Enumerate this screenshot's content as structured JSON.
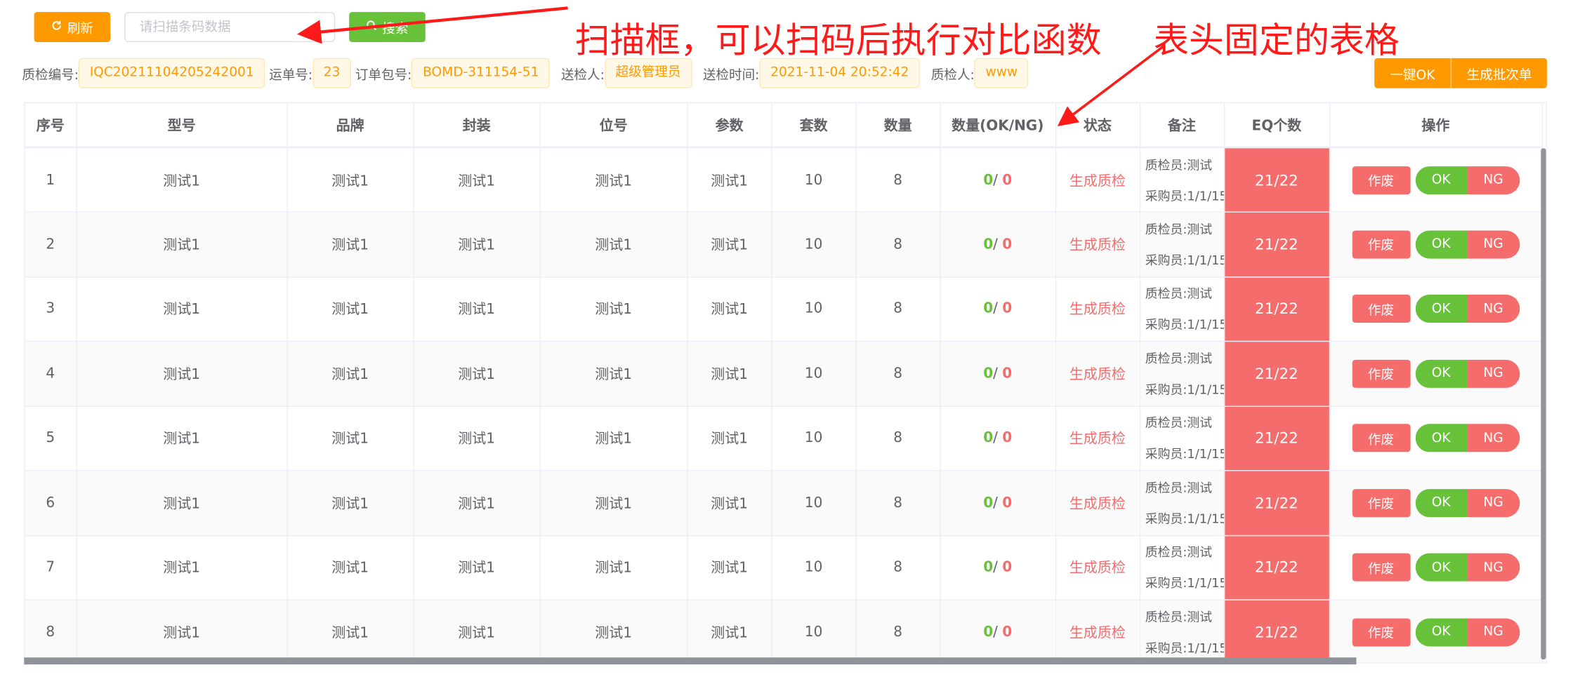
{
  "toolbar": {
    "refresh_label": "刷新",
    "scan_placeholder": "请扫描条码数据",
    "search_label": "搜索"
  },
  "info": {
    "qc_no_label": "质检编号:",
    "qc_no": "IQC20211104205242001",
    "waybill_label": "运单号:",
    "waybill": "23",
    "order_pkg_label": "订单包号:",
    "order_pkg": "BOMD-311154-51",
    "sender_label": "送检人:",
    "sender": "超级管理员",
    "send_time_label": "送检时间:",
    "send_time": "2021-11-04 20:52:42",
    "inspector_label": "质检人:",
    "inspector": "www"
  },
  "actions": {
    "one_key_ok": "一键OK",
    "gen_batch": "生成批次单"
  },
  "annotations": {
    "scan_box": "扫描框，可以扫码后执行对比函数",
    "fixed_header": "表头固定的表格",
    "color": "#ff1a1a"
  },
  "table": {
    "headers": [
      "序号",
      "型号",
      "品牌",
      "封装",
      "位号",
      "参数",
      "套数",
      "数量",
      "数量(OK/NG)",
      "状态",
      "备注",
      "EQ个数",
      "操作"
    ],
    "rows": [
      {
        "no": "1",
        "model": "测试1",
        "brand": "测试1",
        "pkg": "测试1",
        "pos": "测试1",
        "param": "测试1",
        "sets": "10",
        "qty": "8",
        "ok": "0",
        "slash": "/",
        "ng": "0",
        "status": "生成质检",
        "note1": "质检员:测试",
        "note2": "采购员:1/1/15",
        "eq": "21/22",
        "void": "作废",
        "okbtn": "OK",
        "ngbtn": "NG"
      },
      {
        "no": "2",
        "model": "测试1",
        "brand": "测试1",
        "pkg": "测试1",
        "pos": "测试1",
        "param": "测试1",
        "sets": "10",
        "qty": "8",
        "ok": "0",
        "slash": "/",
        "ng": "0",
        "status": "生成质检",
        "note1": "质检员:测试",
        "note2": "采购员:1/1/15",
        "eq": "21/22",
        "void": "作废",
        "okbtn": "OK",
        "ngbtn": "NG"
      },
      {
        "no": "3",
        "model": "测试1",
        "brand": "测试1",
        "pkg": "测试1",
        "pos": "测试1",
        "param": "测试1",
        "sets": "10",
        "qty": "8",
        "ok": "0",
        "slash": "/",
        "ng": "0",
        "status": "生成质检",
        "note1": "质检员:测试",
        "note2": "采购员:1/1/15",
        "eq": "21/22",
        "void": "作废",
        "okbtn": "OK",
        "ngbtn": "NG"
      },
      {
        "no": "4",
        "model": "测试1",
        "brand": "测试1",
        "pkg": "测试1",
        "pos": "测试1",
        "param": "测试1",
        "sets": "10",
        "qty": "8",
        "ok": "0",
        "slash": "/",
        "ng": "0",
        "status": "生成质检",
        "note1": "质检员:测试",
        "note2": "采购员:1/1/15",
        "eq": "21/22",
        "void": "作废",
        "okbtn": "OK",
        "ngbtn": "NG"
      },
      {
        "no": "5",
        "model": "测试1",
        "brand": "测试1",
        "pkg": "测试1",
        "pos": "测试1",
        "param": "测试1",
        "sets": "10",
        "qty": "8",
        "ok": "0",
        "slash": "/",
        "ng": "0",
        "status": "生成质检",
        "note1": "质检员:测试",
        "note2": "采购员:1/1/15",
        "eq": "21/22",
        "void": "作废",
        "okbtn": "OK",
        "ngbtn": "NG"
      },
      {
        "no": "6",
        "model": "测试1",
        "brand": "测试1",
        "pkg": "测试1",
        "pos": "测试1",
        "param": "测试1",
        "sets": "10",
        "qty": "8",
        "ok": "0",
        "slash": "/",
        "ng": "0",
        "status": "生成质检",
        "note1": "质检员:测试",
        "note2": "采购员:1/1/15",
        "eq": "21/22",
        "void": "作废",
        "okbtn": "OK",
        "ngbtn": "NG"
      },
      {
        "no": "7",
        "model": "测试1",
        "brand": "测试1",
        "pkg": "测试1",
        "pos": "测试1",
        "param": "测试1",
        "sets": "10",
        "qty": "8",
        "ok": "0",
        "slash": "/",
        "ng": "0",
        "status": "生成质检",
        "note1": "质检员:测试",
        "note2": "采购员:1/1/15",
        "eq": "21/22",
        "void": "作废",
        "okbtn": "OK",
        "ngbtn": "NG"
      },
      {
        "no": "8",
        "model": "测试1",
        "brand": "测试1",
        "pkg": "测试1",
        "pos": "测试1",
        "param": "测试1",
        "sets": "10",
        "qty": "8",
        "ok": "0",
        "slash": "/",
        "ng": "0",
        "status": "生成质检",
        "note1": "质检员:测试",
        "note2": "采购员:1/1/15",
        "eq": "21/22",
        "void": "作废",
        "okbtn": "OK",
        "ngbtn": "NG"
      }
    ]
  },
  "colors": {
    "orange": "#ff9900",
    "green": "#67c23a",
    "red": "#f56c6c"
  }
}
